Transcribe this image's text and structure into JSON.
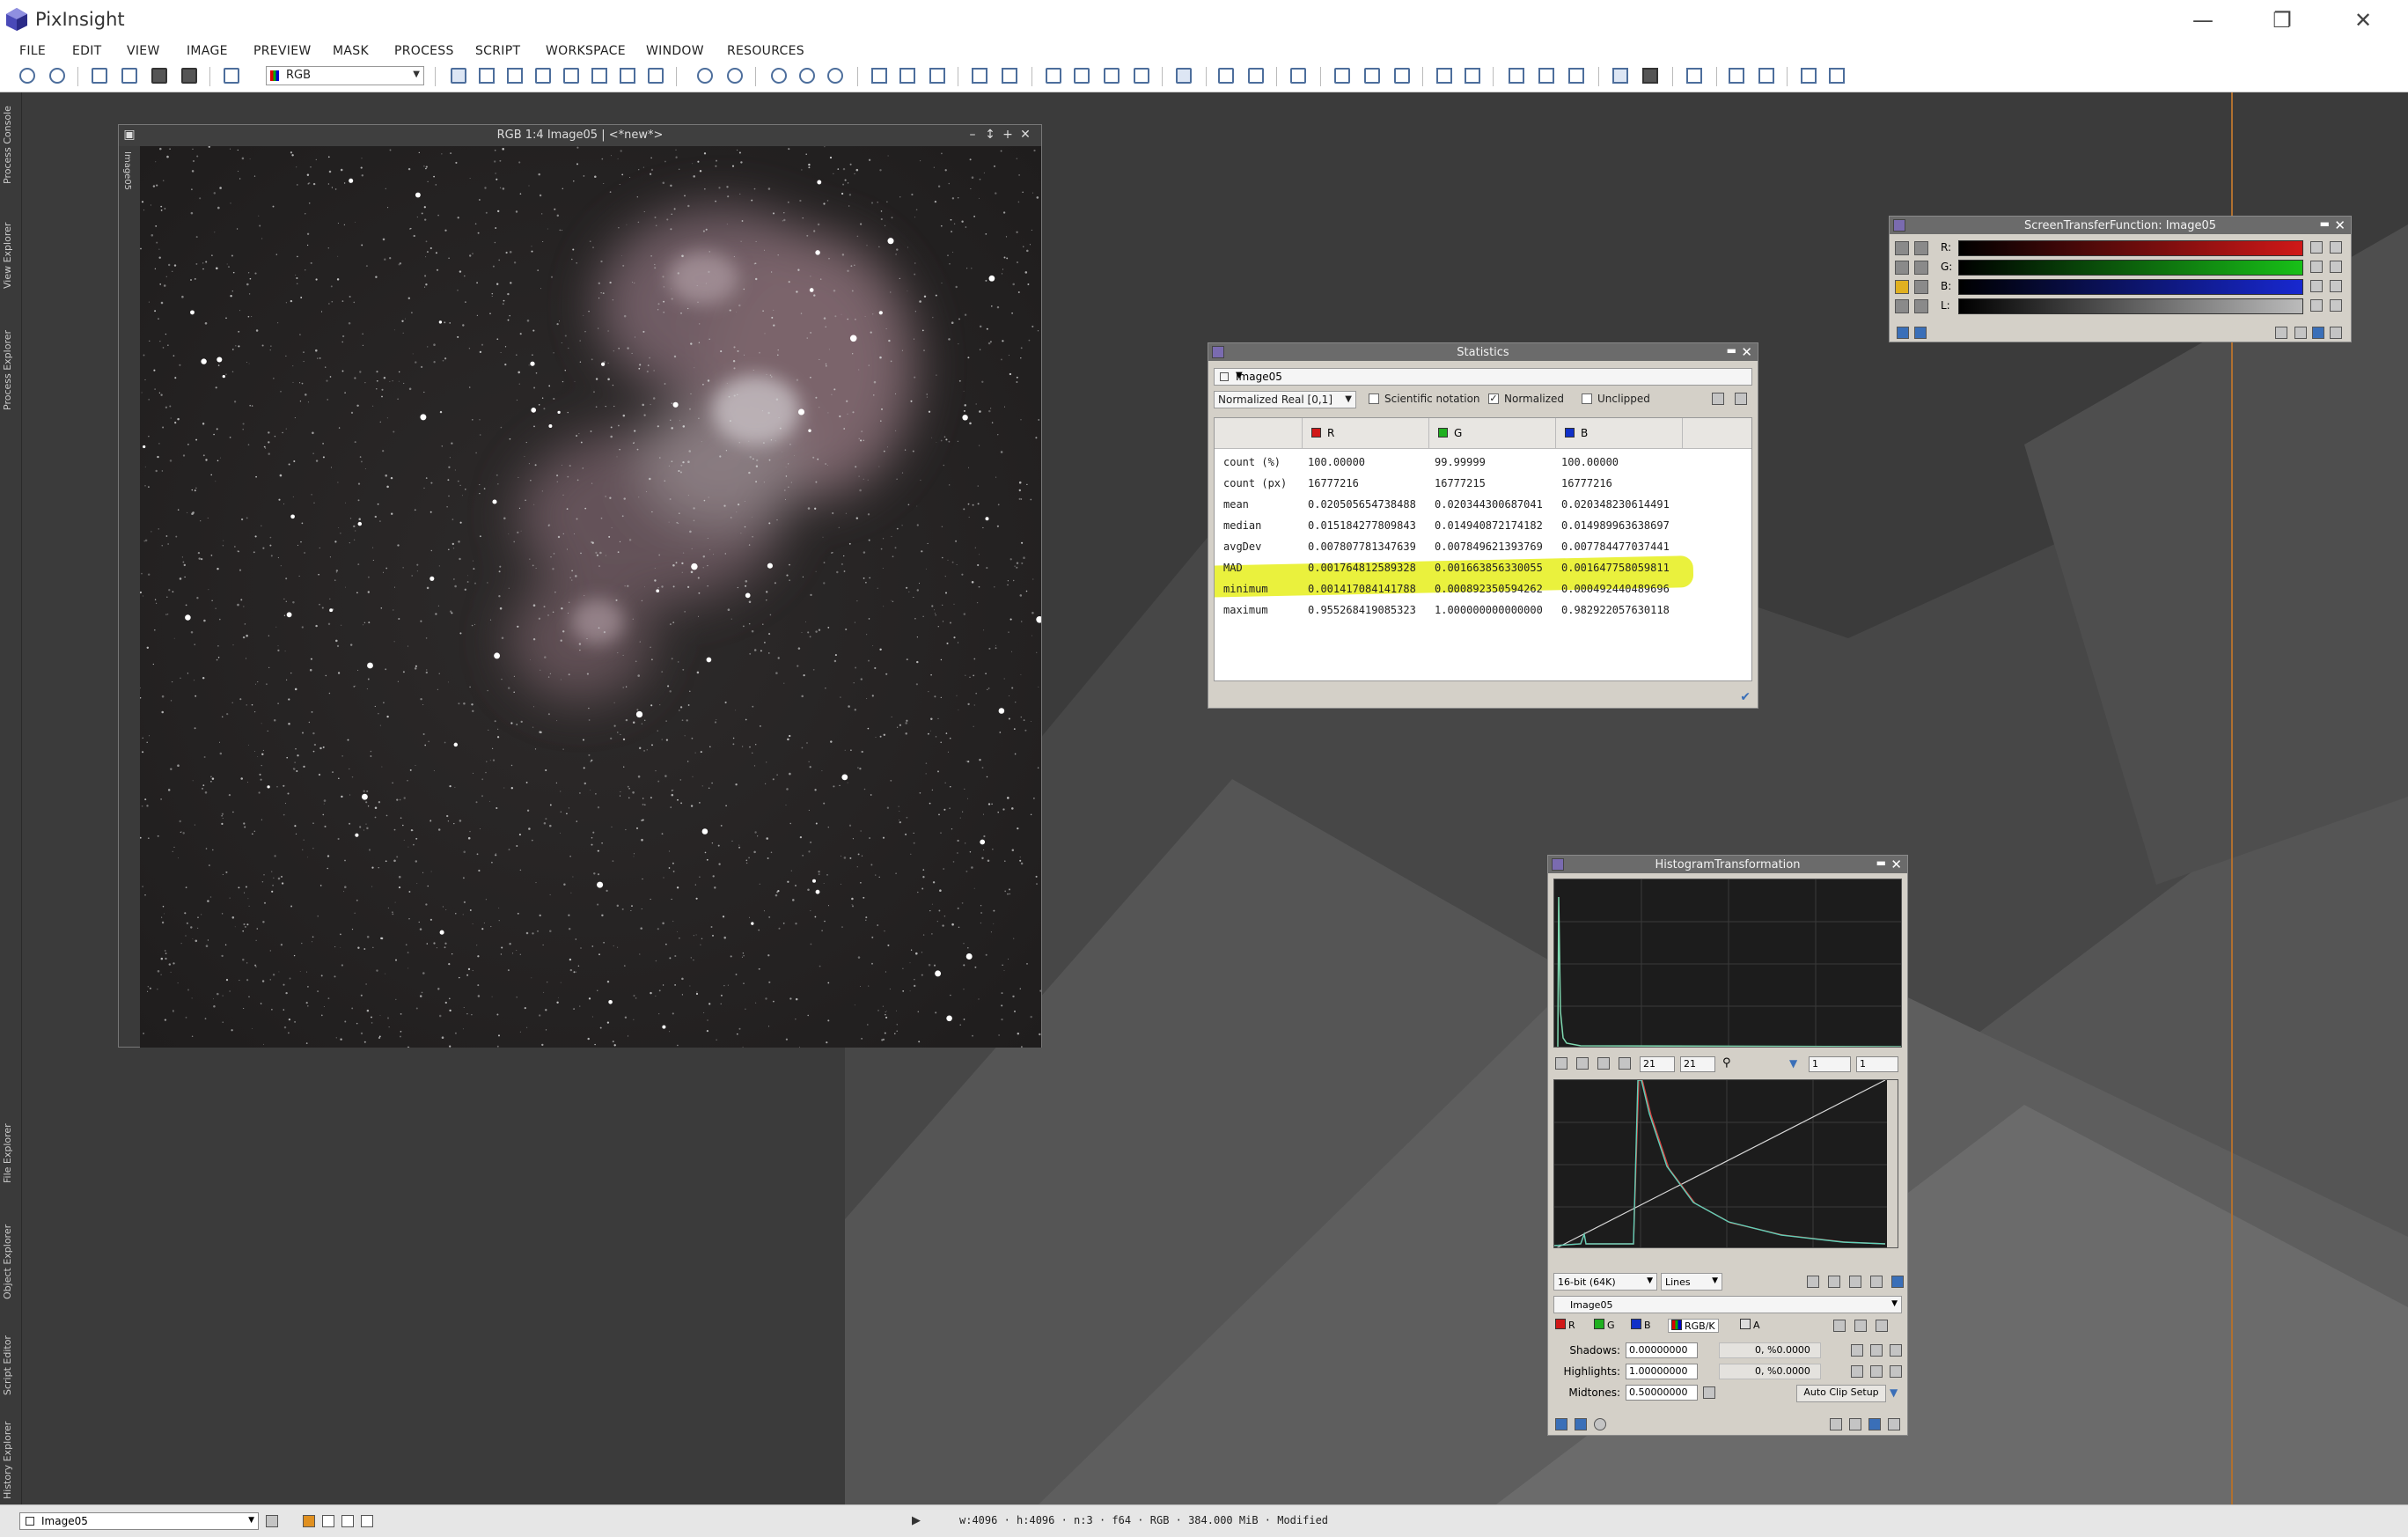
{
  "app": {
    "title": "PixInsight"
  },
  "menu": [
    "FILE",
    "EDIT",
    "VIEW",
    "IMAGE",
    "PREVIEW",
    "MASK",
    "PROCESS",
    "SCRIPT",
    "WORKSPACE",
    "WINDOW",
    "RESOURCES"
  ],
  "toolbar": {
    "mode_select": "RGB"
  },
  "dock_tabs": [
    "Process Console",
    "View Explorer",
    "Process Explorer",
    "File Explorer",
    "Object Explorer",
    "Script Editor",
    "History Explorer"
  ],
  "image_window": {
    "title": "RGB 1:4 Image05 | <*new*>",
    "side_tab": "Image05"
  },
  "statistics": {
    "title": "Statistics",
    "view": "Image05",
    "format": "Normalized Real [0,1]",
    "options": [
      {
        "label": "Scientific notation",
        "checked": false
      },
      {
        "label": "Normalized",
        "checked": true
      },
      {
        "label": "Unclipped",
        "checked": false
      }
    ],
    "columns": [
      {
        "label": "R",
        "color": "#d01818"
      },
      {
        "label": "G",
        "color": "#20b020"
      },
      {
        "label": "B",
        "color": "#1030c8"
      }
    ],
    "rows": [
      {
        "label": "count (%)",
        "values": [
          "100.00000",
          "99.99999",
          "100.00000"
        ]
      },
      {
        "label": "count (px)",
        "values": [
          "16777216",
          "16777215",
          "16777216"
        ]
      },
      {
        "label": "mean",
        "values": [
          "0.020505654738488",
          "0.020344300687041",
          "0.020348230614491"
        ]
      },
      {
        "label": "median",
        "values": [
          "0.015184277809843",
          "0.014940872174182",
          "0.014989963638697"
        ]
      },
      {
        "label": "avgDev",
        "values": [
          "0.007807781347639",
          "0.007849621393769",
          "0.007784477037441"
        ]
      },
      {
        "label": "MAD",
        "values": [
          "0.001764812589328",
          "0.001663856330055",
          "0.001647758059811"
        ]
      },
      {
        "label": "minimum",
        "values": [
          "0.001417084141788",
          "0.000892350594262",
          "0.000492440489696"
        ]
      },
      {
        "label": "maximum",
        "values": [
          "0.955268419085323",
          "1.000000000000000",
          "0.982922057630118"
        ]
      }
    ]
  },
  "stf": {
    "title": "ScreenTransferFunction: Image05",
    "channels": [
      {
        "label": "R:",
        "color": "#d01818"
      },
      {
        "label": "G:",
        "color": "#18c018"
      },
      {
        "label": "B:",
        "color": "#1828d0"
      },
      {
        "label": "L:",
        "color": "#bbbbbb"
      }
    ]
  },
  "histogram": {
    "title": "HistogramTransformation",
    "zoom_h": "21",
    "zoom_v": "21",
    "spin_a": "1",
    "spin_b": "1",
    "resolution": "16-bit (64K)",
    "graph_style": "Lines",
    "view": "Image05",
    "channels": [
      "R",
      "G",
      "B",
      "RGB/K",
      "A"
    ],
    "shadows_label": "Shadows:",
    "shadows": "0.00000000",
    "shadows_clip": "0, %0.0000",
    "highlights_label": "Highlights:",
    "highlights": "1.00000000",
    "highlights_clip": "0, %0.0000",
    "midtones_label": "Midtones:",
    "midtones": "0.50000000",
    "auto_clip": "Auto Clip Setup"
  },
  "statusbar": {
    "view": "Image05",
    "info": "w:4096 · h:4096 · n:3 · f64 · RGB · 384.000 MiB · Modified"
  }
}
